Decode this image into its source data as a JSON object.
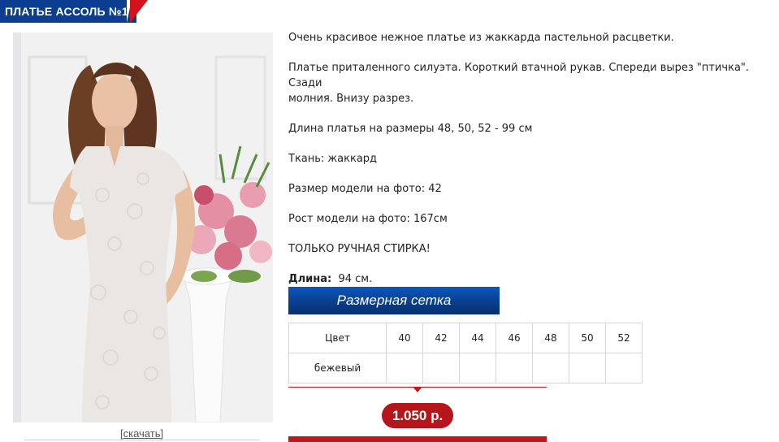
{
  "product": {
    "title": "ПЛАТЬЕ АССОЛЬ №1",
    "download_label": "[скачать]",
    "description_lines": [
      "Очень красивое нежное платье из жаккарда пастельной расцветки.",
      "Платье приталенного силуэта. Короткий втачной рукав. Спереди вырез \"птичка\". Сзади",
      "молния. Внизу разрез.",
      "Длина платья на размеры 48, 50, 52 - 99 см",
      "Ткань: жаккард",
      "Размер модели на фото: 42",
      "Рост модели на фото: 167см",
      "ТОЛЬКО РУЧНАЯ СТИРКА!"
    ],
    "length_label": "Длина:",
    "length_value": "94 см.",
    "size_grid_label": "Размерная сетка",
    "table": {
      "header_first": "Цвет",
      "sizes": [
        "40",
        "42",
        "44",
        "46",
        "48",
        "50",
        "52"
      ],
      "rows": [
        {
          "color": "бежевый",
          "cells": [
            "",
            "",
            "",
            "",
            "",
            "",
            ""
          ]
        }
      ]
    },
    "price": "1.050 р."
  },
  "colors": {
    "brand_blue": "#0b3d91",
    "accent_red": "#c3151d",
    "price_red": "#b5161c"
  }
}
